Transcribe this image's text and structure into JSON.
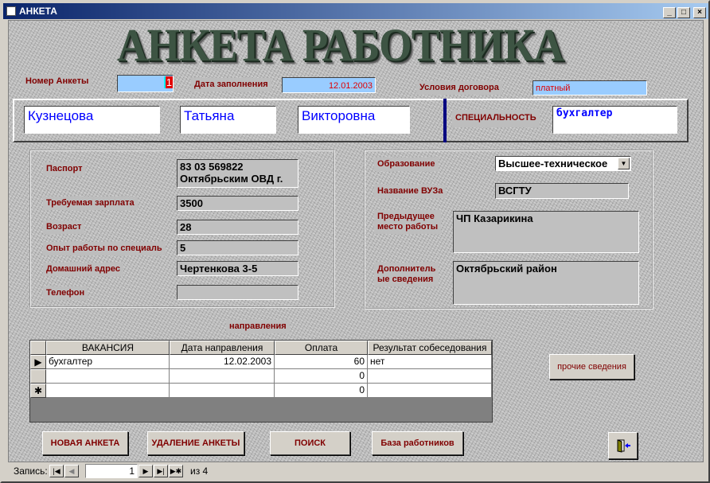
{
  "window": {
    "title": "АНКЕТА",
    "minimize": "_",
    "maximize": "□",
    "close": "×"
  },
  "banner": "АНКЕТА  РАБОТНИКА",
  "header": {
    "number_label": "Номер Анкеты",
    "number_value": "1",
    "date_label": "Дата заполнения",
    "date_value": "12.01.2003",
    "contract_label": "Условия договора",
    "contract_value": "платный"
  },
  "person": {
    "surname": "Кузнецова",
    "name": "Татьяна",
    "patronymic": "Викторовна",
    "specialty_label": "СПЕЦИАЛЬНОСТЬ",
    "specialty_value": "бухгалтер"
  },
  "left": {
    "passport_label": "Паспорт",
    "passport_line1": "83 03 569822",
    "passport_line2": "Октябрьским ОВД г.",
    "salary_label": "Требуемая зарплата",
    "salary_value": "3500",
    "age_label": "Возраст",
    "age_value": "28",
    "experience_label": "Опыт работы по специаль",
    "experience_value": "5",
    "address_label": "Домашний адрес",
    "address_value": "Чертенкова 3-5",
    "phone_label": "Телефон",
    "phone_value": ""
  },
  "right": {
    "education_label": "Образование",
    "education_value": "Высшее-техническое",
    "university_label": "Название ВУЗа",
    "university_value": "ВСГТУ",
    "prev_job_label_1": "Предыдущее",
    "prev_job_label_2": "место работы",
    "prev_job_value": "ЧП Казарикина",
    "extra_label_1": "Дополнитель",
    "extra_label_2": "ые сведения",
    "extra_value": "Октябрьский район"
  },
  "referrals_label": "направления",
  "grid": {
    "columns": [
      "ВАКАНСИЯ",
      "Дата направления",
      "Оплата",
      "Результат собеседования"
    ],
    "rows": [
      {
        "selector": "▶",
        "vacancy": "бухгалтер",
        "date": "12.02.2003",
        "payment": "60",
        "result": "нет"
      },
      {
        "selector": "",
        "vacancy": "",
        "date": "",
        "payment": "0",
        "result": ""
      },
      {
        "selector": "✱",
        "vacancy": "",
        "date": "",
        "payment": "0",
        "result": ""
      }
    ]
  },
  "buttons": {
    "other_info": "прочие сведения",
    "new": "НОВАЯ АНКЕТА",
    "delete": "УДАЛЕНИЕ АНКЕТЫ",
    "search": "ПОИСК",
    "database": "База работников"
  },
  "navigator": {
    "label": "Запись:",
    "current": "1",
    "of": "из  4",
    "first": "|◀",
    "prev": "◀",
    "next": "▶",
    "last": "▶|",
    "new": "▶✱"
  }
}
